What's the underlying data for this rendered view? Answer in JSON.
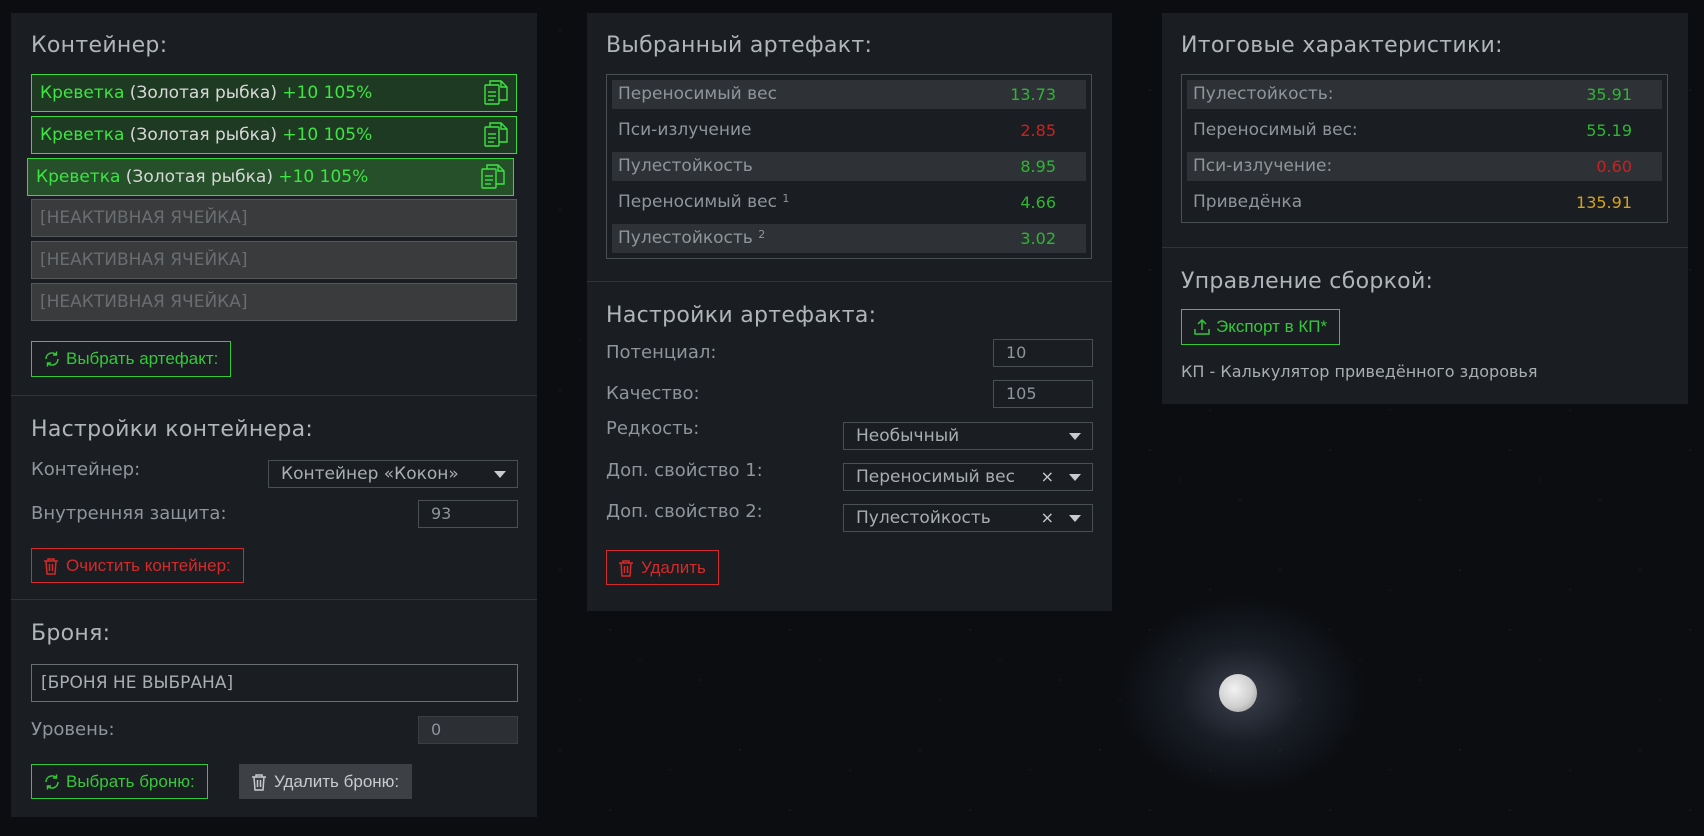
{
  "container_panel": {
    "title": "Контейнер:",
    "slots": [
      {
        "name": "Креветка",
        "base": "(Золотая рыбка)",
        "extra": "+10 105%"
      },
      {
        "name": "Креветка",
        "base": "(Золотая рыбка)",
        "extra": "+10 105%"
      },
      {
        "name": "Креветка",
        "base": "(Золотая рыбка)",
        "extra": "+10 105%"
      }
    ],
    "inactive_slots": [
      "[НЕАКТИВНАЯ ЯЧЕЙКА]",
      "[НЕАКТИВНАЯ ЯЧЕЙКА]",
      "[НЕАКТИВНАЯ ЯЧЕЙКА]"
    ],
    "select_artifact_label": "Выбрать артефакт:",
    "settings_title": "Настройки контейнера:",
    "container_label": "Контейнер:",
    "container_value": "Контейнер «Кокон»",
    "inner_protection_label": "Внутренняя защита:",
    "inner_protection_value": "93",
    "clear_label": "Очистить контейнер:",
    "armor_title": "Броня:",
    "armor_value": "[БРОНЯ НЕ ВЫБРАНА]",
    "level_label": "Уровень:",
    "level_value": "0",
    "select_armor_label": "Выбрать броню:",
    "delete_armor_label": "Удалить броню:"
  },
  "artifact_panel": {
    "title": "Выбранный артефакт:",
    "stats": [
      {
        "label": "Переносимый вес",
        "sup": "",
        "value": "13.73",
        "color": "green"
      },
      {
        "label": "Пси-излучение",
        "sup": "",
        "value": "2.85",
        "color": "red"
      },
      {
        "label": "Пулестойкость",
        "sup": "",
        "value": "8.95",
        "color": "green"
      },
      {
        "label": "Переносимый вес",
        "sup": "1",
        "value": "4.66",
        "color": "green"
      },
      {
        "label": "Пулестойкость",
        "sup": "2",
        "value": "3.02",
        "color": "green"
      }
    ],
    "settings_title": "Настройки артефакта:",
    "potential_label": "Потенциал:",
    "potential_value": "10",
    "quality_label": "Качество:",
    "quality_value": "105",
    "rarity_label": "Редкость:",
    "rarity_value": "Необычный",
    "prop1_label": "Доп. свойство 1:",
    "prop1_value": "Переносимый вес",
    "prop2_label": "Доп. свойство 2:",
    "prop2_value": "Пулестойкость",
    "clear_symbol": "×",
    "delete_label": "Удалить"
  },
  "totals_panel": {
    "title": "Итоговые характеристики:",
    "stats": [
      {
        "label": "Пулестойкость:",
        "value": "35.91",
        "color": "green"
      },
      {
        "label": "Переносимый вес:",
        "value": "55.19",
        "color": "green"
      },
      {
        "label": "Пси-излучение:",
        "value": "0.60",
        "color": "red"
      },
      {
        "label": "Приведёнка",
        "value": "135.91",
        "color": "orange"
      }
    ],
    "build_title": "Управление сборкой:",
    "export_label": "Экспорт в КП*",
    "footnote": "КП - Калькулятор приведённого здоровья"
  },
  "colors": {
    "green": "#35c83a",
    "red": "#d42a2a",
    "orange": "#d6a21e",
    "panel": "#1a1d21"
  }
}
